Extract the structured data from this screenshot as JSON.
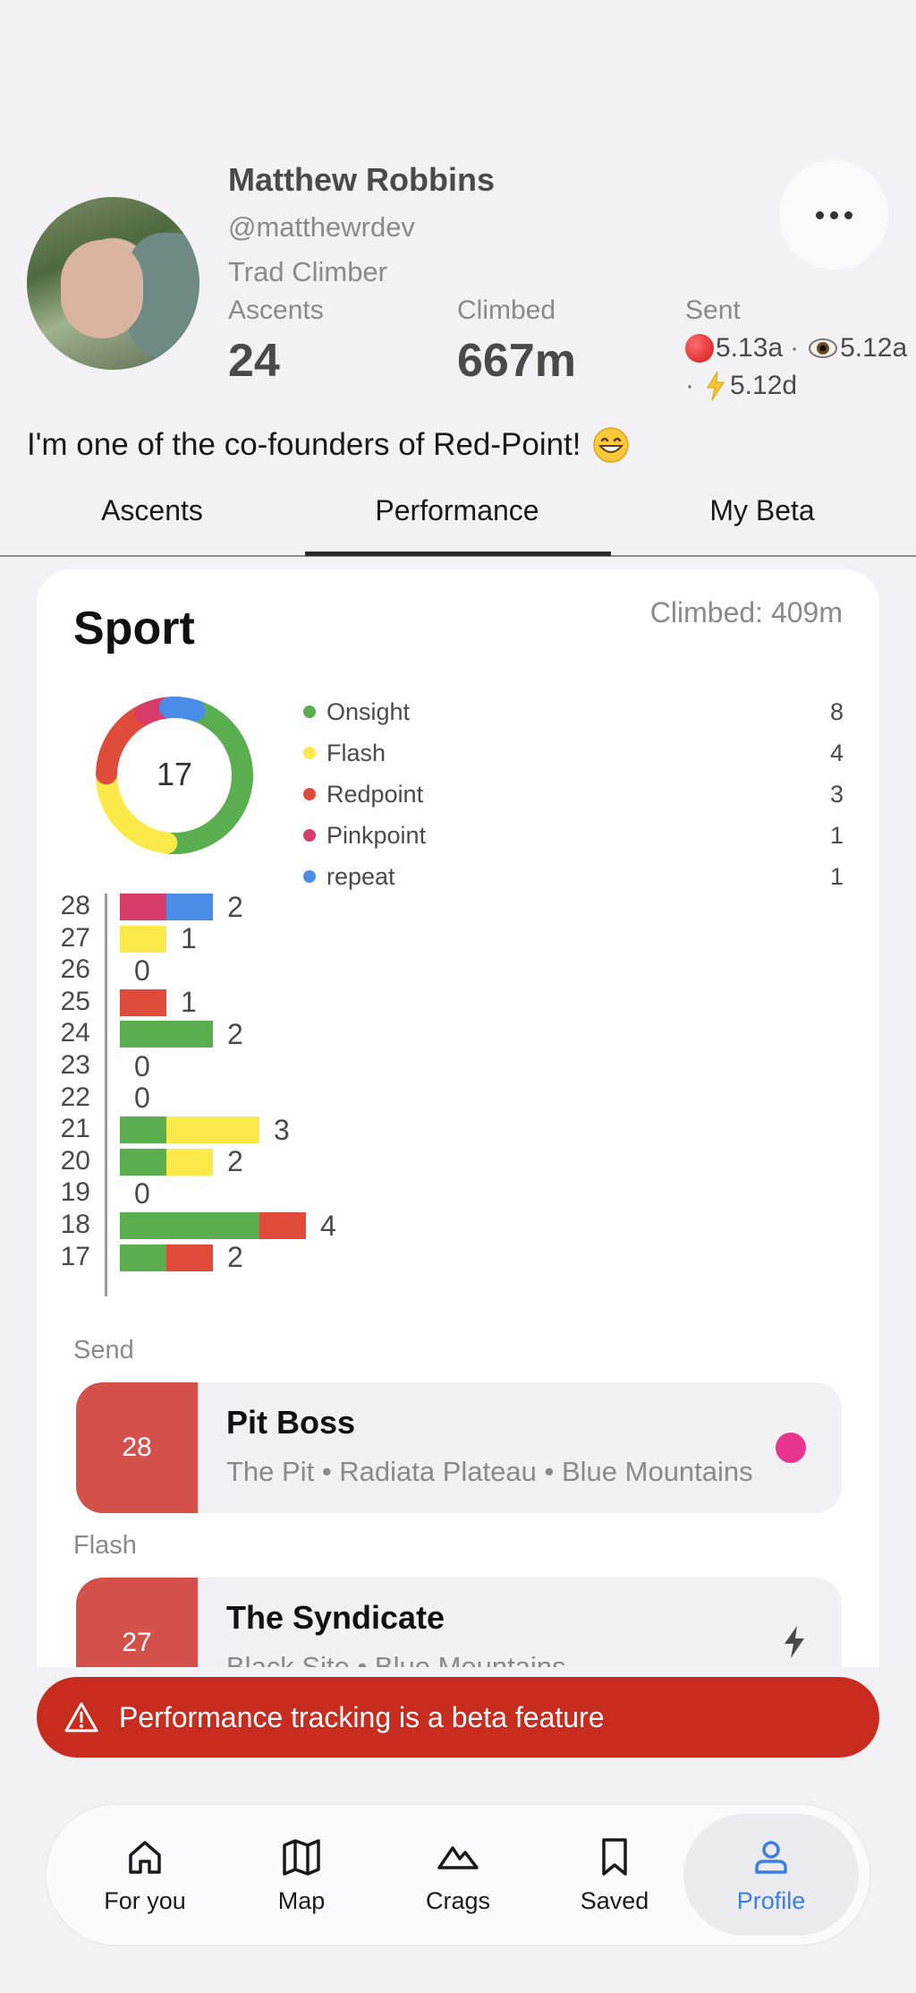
{
  "profile": {
    "name": "Matthew Robbins",
    "handle": "@matthewrdev",
    "role": "Trad Climber",
    "bio": "I'm one of the co-founders of Red-Point!",
    "stats": {
      "ascents_label": "Ascents",
      "ascents_value": "24",
      "climbed_label": "Climbed",
      "climbed_value": "667m",
      "sent_label": "Sent",
      "sent_redpoint": "5.13a",
      "sent_onsight": "5.12a",
      "sent_flash": "5.12d",
      "separator": "·"
    }
  },
  "tabs": [
    {
      "label": "Ascents",
      "active": false
    },
    {
      "label": "Performance",
      "active": true
    },
    {
      "label": "My Beta",
      "active": false
    }
  ],
  "card": {
    "title": "Sport",
    "climbed": "Climbed: 409m",
    "total": "17"
  },
  "colors": {
    "onsight": "#5aae50",
    "flash": "#fbe94a",
    "redpoint": "#e04c3b",
    "pinkpoint": "#d83c6a",
    "repeat": "#4a8de8"
  },
  "legend": [
    {
      "key": "onsight",
      "label": "Onsight",
      "count": "8"
    },
    {
      "key": "flash",
      "label": "Flash",
      "count": "4"
    },
    {
      "key": "redpoint",
      "label": "Redpoint",
      "count": "3"
    },
    {
      "key": "pinkpoint",
      "label": "Pinkpoint",
      "count": "1"
    },
    {
      "key": "repeat",
      "label": "repeat",
      "count": "1"
    }
  ],
  "chart_data": {
    "type": "bar",
    "orientation": "horizontal",
    "stacked": true,
    "categories": [
      "28",
      "27",
      "26",
      "25",
      "24",
      "23",
      "22",
      "21",
      "20",
      "19",
      "18",
      "17"
    ],
    "totals": [
      2,
      1,
      0,
      1,
      2,
      0,
      0,
      3,
      2,
      0,
      4,
      2
    ],
    "series": [
      {
        "name": "Onsight",
        "key": "onsight",
        "values": [
          0,
          0,
          0,
          0,
          2,
          0,
          0,
          1,
          1,
          0,
          3,
          1
        ]
      },
      {
        "name": "Flash",
        "key": "flash",
        "values": [
          0,
          1,
          0,
          0,
          0,
          0,
          0,
          2,
          1,
          0,
          0,
          0
        ]
      },
      {
        "name": "Redpoint",
        "key": "redpoint",
        "values": [
          0,
          0,
          0,
          1,
          0,
          0,
          0,
          0,
          0,
          0,
          1,
          1
        ]
      },
      {
        "name": "Pinkpoint",
        "key": "pinkpoint",
        "values": [
          1,
          0,
          0,
          0,
          0,
          0,
          0,
          0,
          0,
          0,
          0,
          0
        ]
      },
      {
        "name": "repeat",
        "key": "repeat",
        "values": [
          1,
          0,
          0,
          0,
          0,
          0,
          0,
          0,
          0,
          0,
          0,
          0
        ]
      }
    ],
    "donut": {
      "type": "pie",
      "style": "donut",
      "center_label": "17",
      "values": [
        8,
        4,
        3,
        1,
        1
      ],
      "labels": [
        "Onsight",
        "Flash",
        "Redpoint",
        "Pinkpoint",
        "repeat"
      ]
    }
  },
  "highlights": [
    {
      "section": "Send",
      "grade": "28",
      "name": "Pit Boss",
      "location": "The Pit • Radiata Plateau • Blue Mountains",
      "icon": "pinkpoint-dot-icon"
    },
    {
      "section": "Flash",
      "grade": "27",
      "name": "The Syndicate",
      "location": "Black Site • Blue Mountains",
      "icon": "bolt-icon"
    }
  ],
  "banner": {
    "text": "Performance tracking is a beta feature",
    "icon": "warning-icon"
  },
  "nav": [
    {
      "label": "For you",
      "icon": "home-icon",
      "active": false
    },
    {
      "label": "Map",
      "icon": "map-icon",
      "active": false
    },
    {
      "label": "Crags",
      "icon": "mountain-icon",
      "active": false
    },
    {
      "label": "Saved",
      "icon": "bookmark-icon",
      "active": false
    },
    {
      "label": "Profile",
      "icon": "user-icon",
      "active": true
    }
  ]
}
